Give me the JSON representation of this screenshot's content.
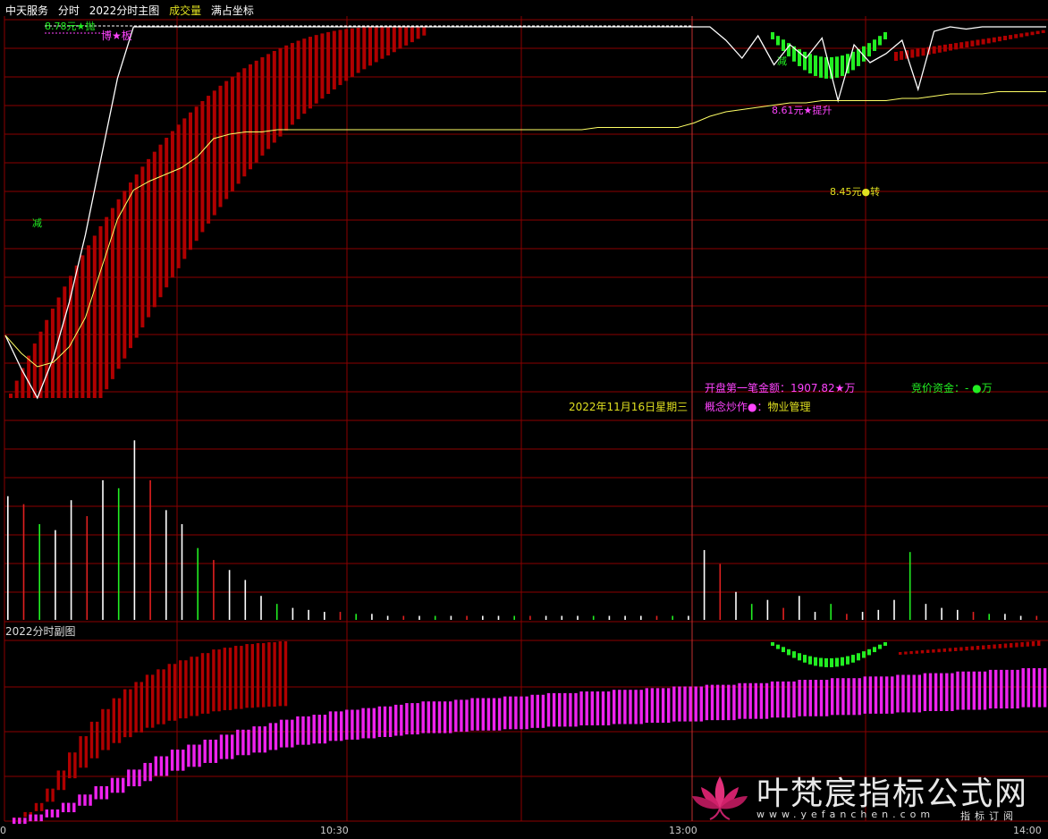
{
  "header": {
    "stock_name": "中天服务",
    "mode": "分时",
    "indicator": "2022分时主图",
    "volume": "成交量",
    "coord": "满占坐标"
  },
  "sub_panel_title": "2022分时副图",
  "time_labels": [
    "0",
    "10:30",
    "13:00",
    "14:00"
  ],
  "annotations": {
    "high_price": "8.78元",
    "high_tag": "★抛",
    "bo_ban": "博★板",
    "jian_left": "减",
    "jian_right": "减",
    "tisheng": "8.61元★提升",
    "zhuan": "8.45元●转"
  },
  "info": {
    "date": "2022年11月16日星期三",
    "open_amount_label": "开盘第一笔金额：",
    "open_amount_value": "1907.82★万",
    "bid_fund": "竞价资金：- ●万",
    "concept_label": "概念炒作●：",
    "concept_value": "物业管理"
  },
  "watermark": {
    "name": "叶梵宸指标公式网",
    "url": "www.yefanchen.com",
    "tag": "指标订阅"
  },
  "colors": {
    "grid": "#8b0000",
    "price_line": "#ffffff",
    "avg_line": "#ffff66",
    "red_bar": "#b00000",
    "green_bar": "#22ee22",
    "magenta_bar": "#ee22ee",
    "title_yellow": "#e0e020",
    "title_magenta": "#ff44ff"
  },
  "chart_data": [
    {
      "type": "line",
      "title": "2022分时主图",
      "price_high": 8.78,
      "price_low": 8.45,
      "series": [
        {
          "name": "price",
          "values": [
            7.4,
            7.25,
            7.12,
            7.3,
            7.55,
            7.85,
            8.2,
            8.55,
            8.78,
            8.78,
            8.78,
            8.78,
            8.78,
            8.78,
            8.78,
            8.78,
            8.78,
            8.78,
            8.78,
            8.78,
            8.78,
            8.78,
            8.78,
            8.78,
            8.78,
            8.78,
            8.78,
            8.78,
            8.78,
            8.78,
            8.78,
            8.78,
            8.78,
            8.78,
            8.78,
            8.78,
            8.78,
            8.78,
            8.78,
            8.78,
            8.78,
            8.78,
            8.78,
            8.78,
            8.78,
            8.72,
            8.64,
            8.74,
            8.61,
            8.7,
            8.64,
            8.73,
            8.45,
            8.7,
            8.62,
            8.66,
            8.72,
            8.5,
            8.76,
            8.78,
            8.77,
            8.78,
            8.78,
            8.78,
            8.78,
            8.78
          ]
        },
        {
          "name": "avg",
          "values": [
            7.4,
            7.32,
            7.26,
            7.28,
            7.35,
            7.48,
            7.7,
            7.92,
            8.05,
            8.09,
            8.12,
            8.15,
            8.2,
            8.28,
            8.3,
            8.31,
            8.31,
            8.32,
            8.32,
            8.32,
            8.32,
            8.32,
            8.32,
            8.32,
            8.32,
            8.32,
            8.32,
            8.32,
            8.32,
            8.32,
            8.32,
            8.32,
            8.32,
            8.32,
            8.32,
            8.32,
            8.32,
            8.33,
            8.33,
            8.33,
            8.33,
            8.33,
            8.33,
            8.35,
            8.38,
            8.4,
            8.41,
            8.42,
            8.43,
            8.44,
            8.44,
            8.45,
            8.45,
            8.45,
            8.45,
            8.45,
            8.46,
            8.46,
            8.47,
            8.48,
            8.48,
            8.48,
            8.49,
            8.49,
            8.49,
            8.49
          ]
        }
      ]
    },
    {
      "type": "bar",
      "title": "成交量",
      "values": [
        62,
        58,
        48,
        45,
        60,
        52,
        70,
        66,
        90,
        70,
        55,
        48,
        36,
        30,
        25,
        20,
        12,
        8,
        6,
        5,
        4,
        4,
        3,
        3,
        2,
        2,
        2,
        2,
        2,
        2,
        2,
        2,
        2,
        2,
        2,
        2,
        2,
        2,
        2,
        2,
        2,
        2,
        2,
        2,
        35,
        28,
        14,
        8,
        10,
        6,
        12,
        4,
        8,
        3,
        4,
        5,
        10,
        34,
        8,
        6,
        5,
        4,
        3,
        3,
        2,
        2
      ]
    },
    {
      "type": "bar",
      "title": "2022分时副图",
      "series": [
        {
          "name": "red",
          "values": [
            0.02,
            0.05,
            0.1,
            0.18,
            0.28,
            0.38,
            0.47,
            0.55,
            0.62,
            0.68,
            0.73,
            0.77,
            0.81,
            0.84,
            0.87,
            0.89,
            0.91,
            0.93,
            0.95,
            0.96,
            0.97,
            0.98,
            0.985,
            0.99,
            0.995,
            0.998
          ]
        },
        {
          "name": "magenta",
          "values": [
            0.02,
            0.04,
            0.07,
            0.11,
            0.16,
            0.21,
            0.26,
            0.31,
            0.35,
            0.39,
            0.43,
            0.46,
            0.49,
            0.52,
            0.55,
            0.57,
            0.59,
            0.61,
            0.63,
            0.64,
            0.66,
            0.67,
            0.68,
            0.69,
            0.7,
            0.71,
            0.72,
            0.72,
            0.73,
            0.74,
            0.74,
            0.75,
            0.75,
            0.76,
            0.77,
            0.77,
            0.78,
            0.78,
            0.79,
            0.79,
            0.8,
            0.8,
            0.81,
            0.81,
            0.82,
            0.82,
            0.83,
            0.83,
            0.84,
            0.84,
            0.85,
            0.85,
            0.86,
            0.86,
            0.87,
            0.87,
            0.88,
            0.88,
            0.89,
            0.89,
            0.9,
            0.9,
            0.91,
            0.91,
            0.92,
            0.92
          ]
        }
      ]
    }
  ]
}
